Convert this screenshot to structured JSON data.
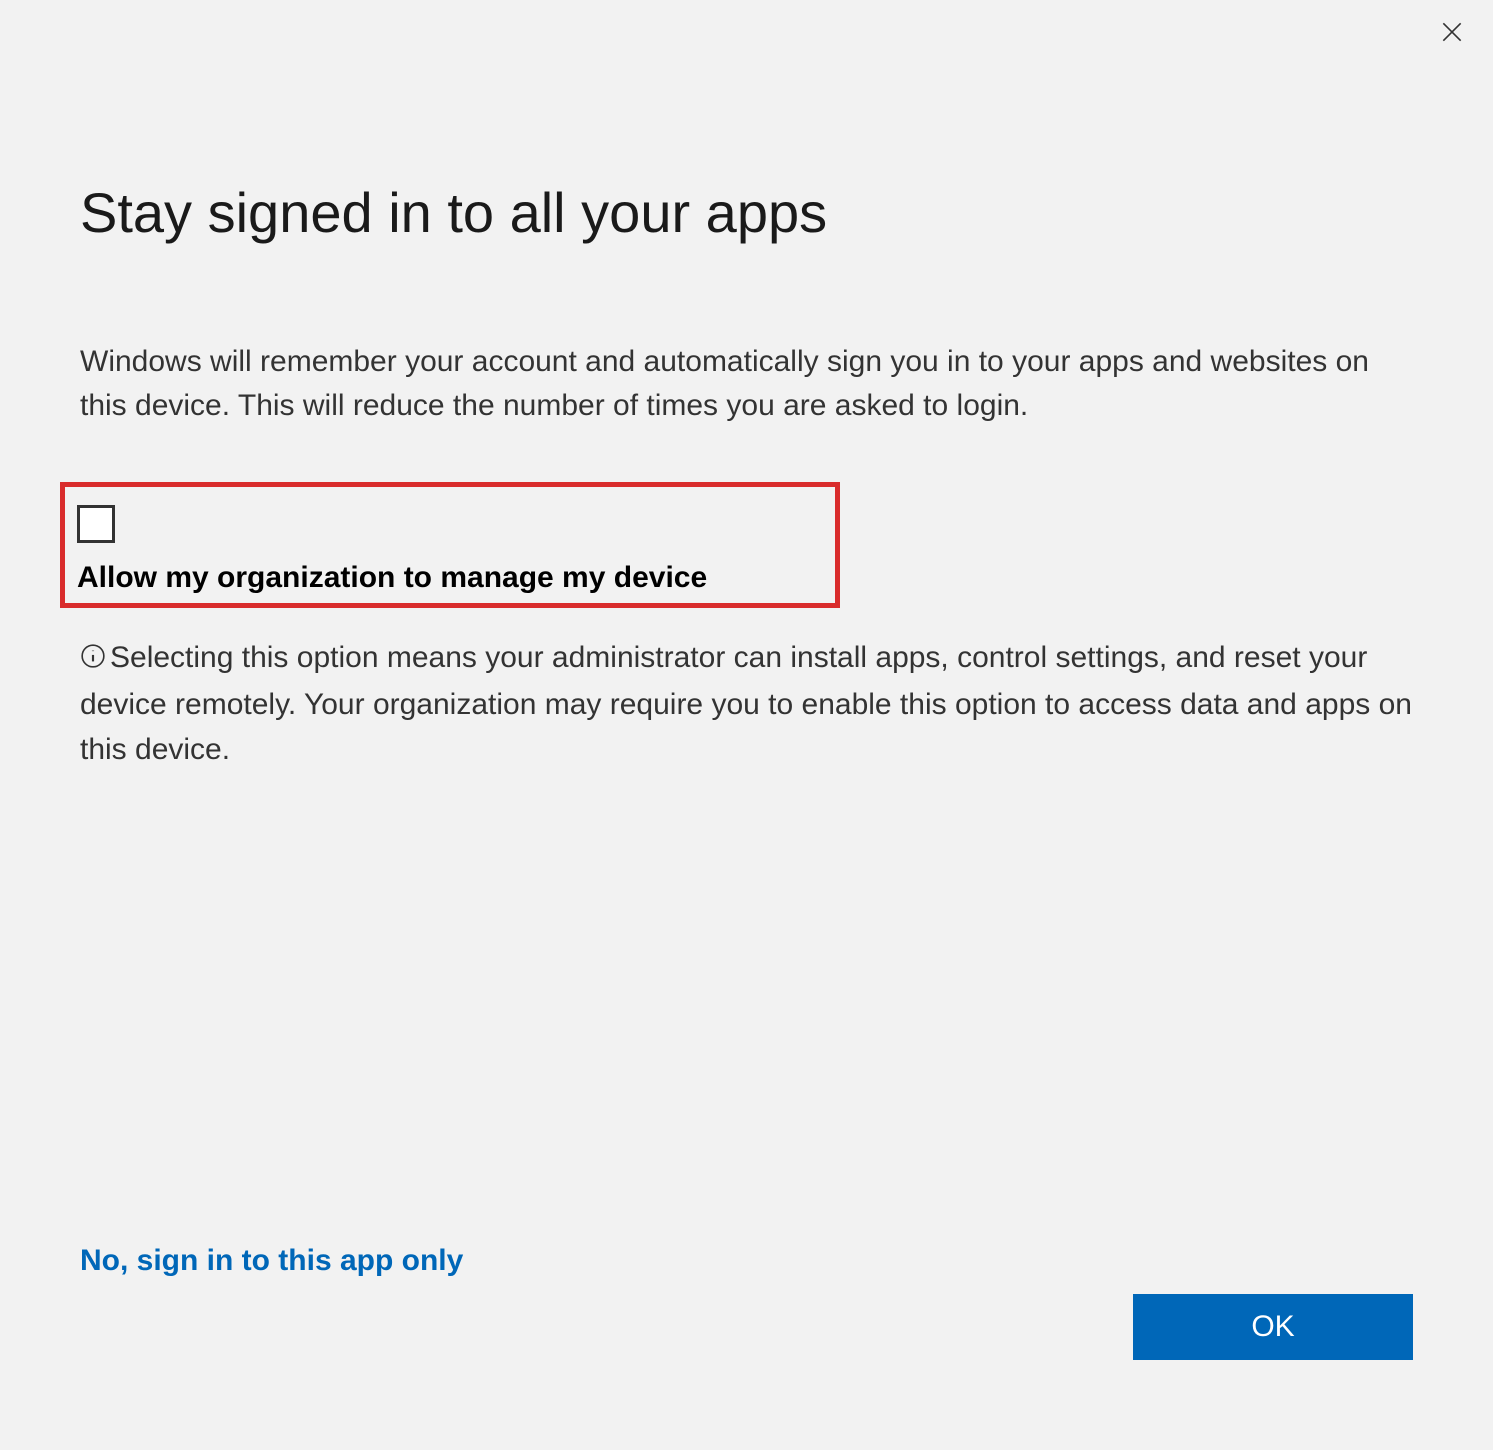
{
  "dialog": {
    "title": "Stay signed in to all your apps",
    "description": "Windows will remember your account and automatically sign you in to your apps and websites on this device. This will reduce the number of times you are asked to login.",
    "checkbox_label": "Allow my organization to manage my device",
    "info_text": "Selecting this option means your administrator can install apps, control settings, and reset your device remotely. Your organization may require you to enable this option to access data and apps on this device.",
    "link_label": "No, sign in to this app only",
    "ok_label": "OK"
  }
}
